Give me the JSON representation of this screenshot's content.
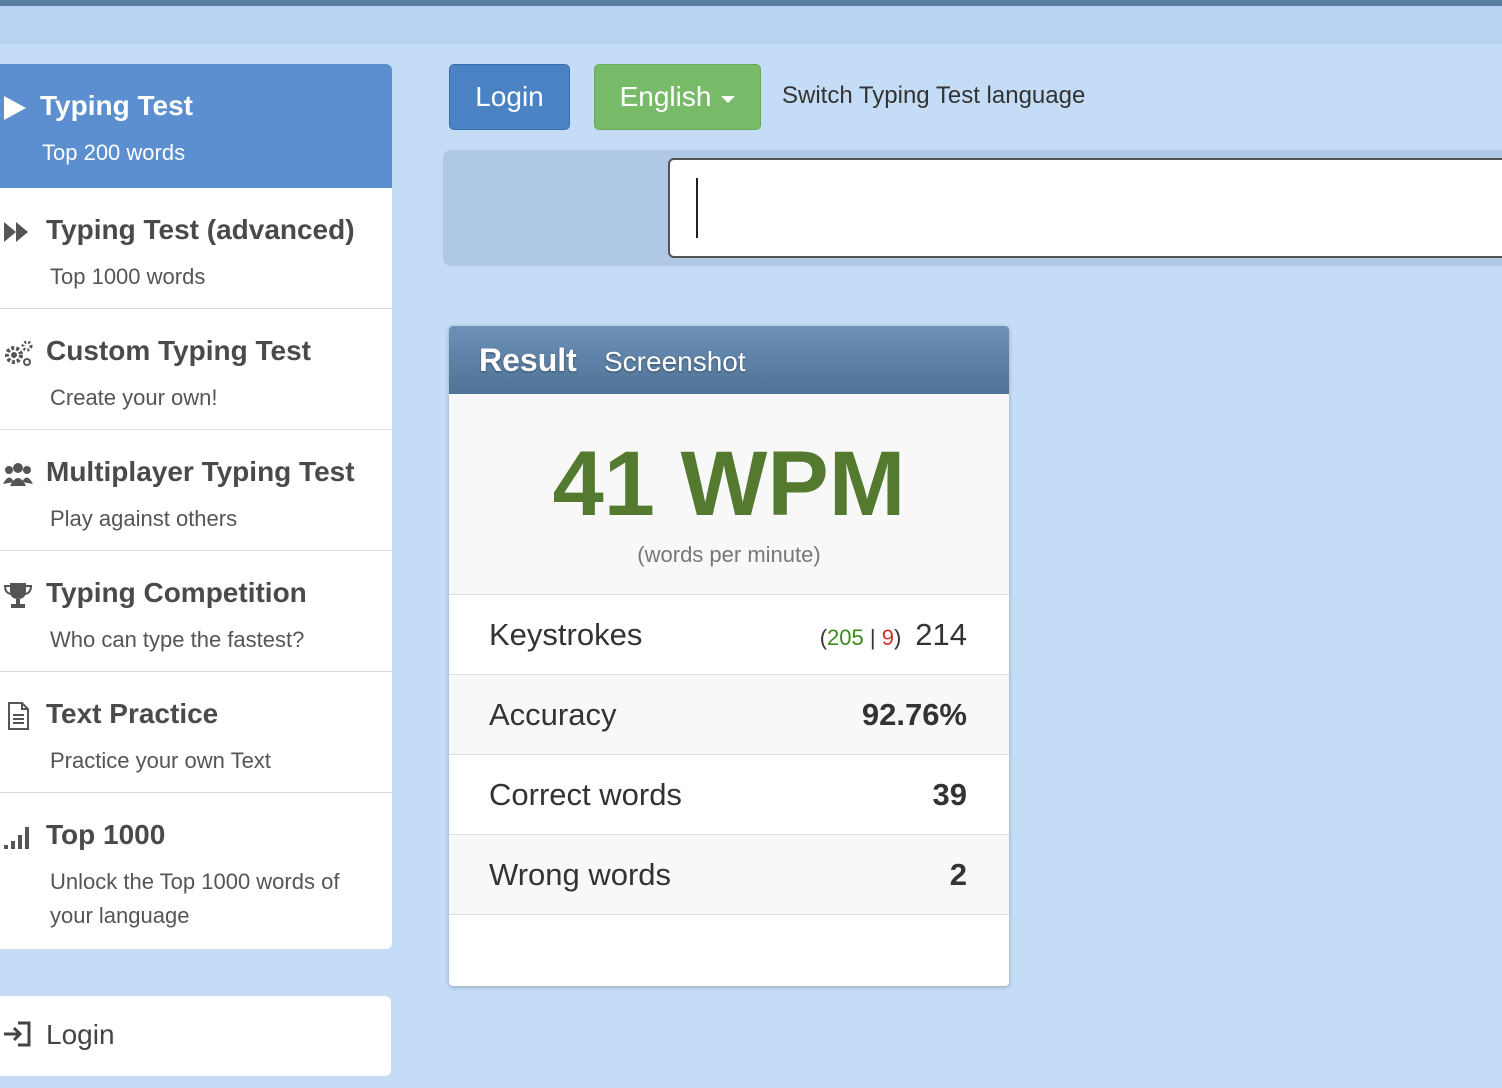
{
  "sidebar": {
    "items": [
      {
        "title": "Typing Test",
        "subtitle": "Top 200 words",
        "icon": "play-icon"
      },
      {
        "title": "Typing Test (advanced)",
        "subtitle": "Top 1000 words",
        "icon": "fast-forward-icon"
      },
      {
        "title": "Custom Typing Test",
        "subtitle": "Create your own!",
        "icon": "gears-icon"
      },
      {
        "title": "Multiplayer Typing Test",
        "subtitle": "Play against others",
        "icon": "users-icon"
      },
      {
        "title": "Typing Competition",
        "subtitle": "Who can type the fastest?",
        "icon": "trophy-icon"
      },
      {
        "title": "Text Practice",
        "subtitle": "Practice your own Text",
        "icon": "document-icon"
      },
      {
        "title": "Top 1000",
        "subtitle": "Unlock the Top 1000 words of your language",
        "icon": "signal-bars-icon"
      }
    ],
    "login_label": "Login"
  },
  "header": {
    "login_label": "Login",
    "language_label": "English",
    "switch_label": "Switch Typing Test language"
  },
  "typing_input": {
    "value": ""
  },
  "result": {
    "title": "Result",
    "screenshot_label": "Screenshot",
    "wpm": "41 WPM",
    "wpm_sub": "(words per minute)",
    "keystrokes_label": "Keystrokes",
    "keystrokes_correct": "205",
    "keystrokes_wrong": "9",
    "keystrokes_total": "214",
    "accuracy_label": "Accuracy",
    "accuracy_value": "92.76%",
    "correct_label": "Correct words",
    "correct_value": "39",
    "wrong_label": "Wrong words",
    "wrong_value": "2"
  },
  "colors": {
    "background": "#c4dcf6",
    "active_sidebar": "#5b8fd0",
    "login_button": "#4a82c4",
    "language_button": "#77ba68",
    "wpm_green": "#537a2e",
    "correct_green": "#3a8a1e",
    "wrong_red": "#d32f22"
  }
}
